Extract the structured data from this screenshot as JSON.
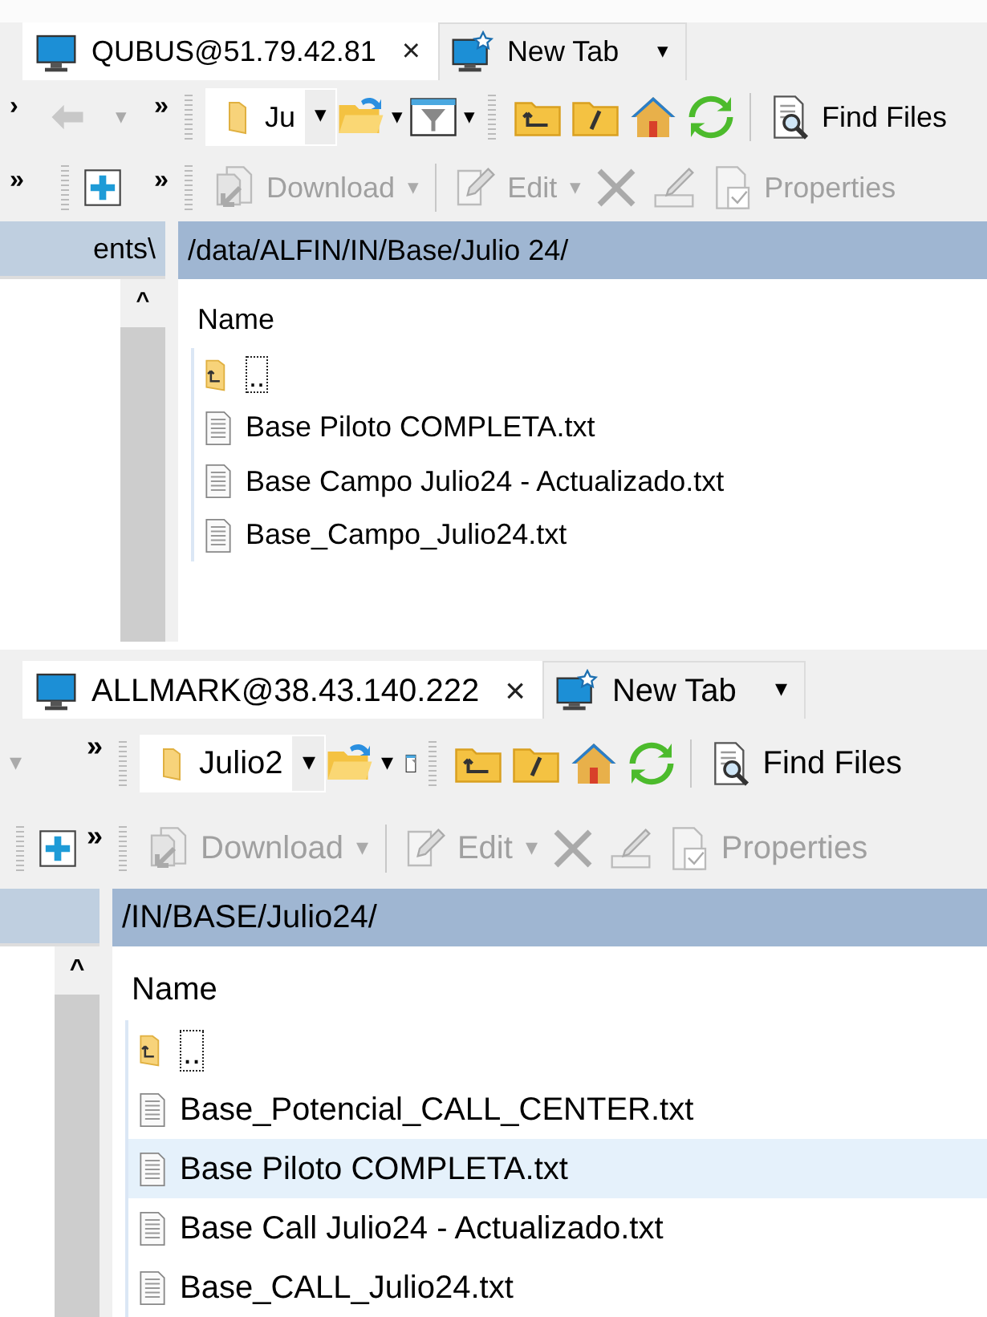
{
  "sessions": [
    {
      "tab": {
        "title": "QUBUS@51.79.42.81",
        "close": "×",
        "selected": true
      },
      "new_tab": {
        "label": "New Tab",
        "caret": "▾",
        "selected": false
      },
      "left_row1": [
        {
          "kind": "chevron",
          "text": "›"
        },
        {
          "kind": "back",
          "disabled": true
        },
        {
          "kind": "caret",
          "text": "▾",
          "disabled": true
        },
        {
          "kind": "chevron",
          "text": "»"
        }
      ],
      "left_row2": [
        {
          "kind": "chevron",
          "text": "»"
        },
        {
          "kind": "add"
        },
        {
          "kind": "chevron",
          "text": "»"
        }
      ],
      "folder_combo": {
        "value": "Ju",
        "caret": "▾"
      },
      "filter_full": true,
      "find_files": "Find Files",
      "commands": [
        {
          "kind": "download",
          "label": "Download",
          "caret": "▾",
          "disabled": true
        },
        {
          "kind": "edit",
          "label": "Edit",
          "caret": "▾",
          "disabled": true
        },
        {
          "kind": "delete",
          "disabled": true
        },
        {
          "kind": "rename",
          "disabled": true
        },
        {
          "kind": "properties",
          "label": "Properties",
          "disabled": true
        }
      ],
      "left_path": "ents\\",
      "scroll_up": "^",
      "path": "/data/ALFIN/IN/Base/Julio 24/",
      "column": "Name",
      "files": [
        {
          "kind": "parent",
          "name": "..",
          "selected": false
        },
        {
          "kind": "file",
          "name": "Base Piloto COMPLETA.txt",
          "selected": false
        },
        {
          "kind": "file",
          "name": "Base Campo Julio24 - Actualizado.txt",
          "selected": false
        },
        {
          "kind": "file",
          "name": "Base_Campo_Julio24.txt",
          "selected": false
        }
      ]
    },
    {
      "tab": {
        "title": "ALLMARK@38.43.140.222",
        "close": "×",
        "selected": true
      },
      "new_tab": {
        "label": "New Tab",
        "caret": "▾",
        "selected": false
      },
      "left_row1": [
        {
          "kind": "caret",
          "text": "▾",
          "disabled": true
        },
        {
          "kind": "chevron",
          "text": "»"
        }
      ],
      "left_row2": [
        {
          "kind": "add"
        },
        {
          "kind": "chevron",
          "text": "»"
        }
      ],
      "folder_combo": {
        "value": "Julio2",
        "caret": "▾"
      },
      "filter_full": false,
      "find_files": "Find Files",
      "commands": [
        {
          "kind": "download",
          "label": "Download",
          "caret": "▾",
          "disabled": true
        },
        {
          "kind": "edit",
          "label": "Edit",
          "caret": "▾",
          "disabled": true
        },
        {
          "kind": "delete",
          "disabled": true
        },
        {
          "kind": "rename",
          "disabled": true
        },
        {
          "kind": "properties",
          "label": "Properties",
          "disabled": true
        }
      ],
      "scroll_up": "^",
      "path": "/IN/BASE/Julio24/",
      "column": "Name",
      "files": [
        {
          "kind": "parent",
          "name": "..",
          "selected": false
        },
        {
          "kind": "file",
          "name": "Base_Potencial_CALL_CENTER.txt",
          "selected": false
        },
        {
          "kind": "file",
          "name": "Base Piloto COMPLETA.txt",
          "selected": true
        },
        {
          "kind": "file",
          "name": "Base Call Julio24 - Actualizado.txt",
          "selected": false
        },
        {
          "kind": "file",
          "name": "Base_CALL_Julio24.txt",
          "selected": false
        }
      ]
    }
  ]
}
